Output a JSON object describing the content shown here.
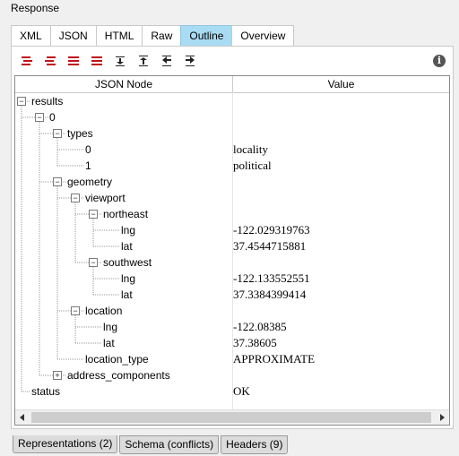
{
  "header": {
    "title": "Response"
  },
  "tabs": [
    {
      "label": "XML",
      "active": false
    },
    {
      "label": "JSON",
      "active": false
    },
    {
      "label": "HTML",
      "active": false
    },
    {
      "label": "Raw",
      "active": false
    },
    {
      "label": "Outline",
      "active": true
    },
    {
      "label": "Overview",
      "active": false
    }
  ],
  "toolbar": {
    "icons": [
      "expand-all-icon",
      "collapse-all-icon",
      "expand-children-icon",
      "collapse-children-icon",
      "move-down-icon",
      "move-up-icon",
      "move-to-top-icon",
      "move-to-bottom-icon"
    ],
    "info_label": "i"
  },
  "tree": {
    "col_node": "JSON Node",
    "col_value": "Value",
    "rows": [
      {
        "label": "results",
        "value": "",
        "depth": 0,
        "expander": "minus"
      },
      {
        "label": "0",
        "value": "",
        "depth": 1,
        "expander": "minus"
      },
      {
        "label": "types",
        "value": "",
        "depth": 2,
        "expander": "minus"
      },
      {
        "label": "0",
        "value": "locality",
        "depth": 3,
        "expander": ""
      },
      {
        "label": "1",
        "value": "political",
        "depth": 3,
        "expander": ""
      },
      {
        "label": "geometry",
        "value": "",
        "depth": 2,
        "expander": "minus"
      },
      {
        "label": "viewport",
        "value": "",
        "depth": 3,
        "expander": "minus"
      },
      {
        "label": "northeast",
        "value": "",
        "depth": 4,
        "expander": "minus"
      },
      {
        "label": "lng",
        "value": "-122.029319763",
        "depth": 5,
        "expander": ""
      },
      {
        "label": "lat",
        "value": "37.4544715881",
        "depth": 5,
        "expander": ""
      },
      {
        "label": "southwest",
        "value": "",
        "depth": 4,
        "expander": "minus"
      },
      {
        "label": "lng",
        "value": "-122.133552551",
        "depth": 5,
        "expander": ""
      },
      {
        "label": "lat",
        "value": "37.3384399414",
        "depth": 5,
        "expander": ""
      },
      {
        "label": "location",
        "value": "",
        "depth": 3,
        "expander": "minus"
      },
      {
        "label": "lng",
        "value": "-122.08385",
        "depth": 4,
        "expander": ""
      },
      {
        "label": "lat",
        "value": "37.38605",
        "depth": 4,
        "expander": ""
      },
      {
        "label": "location_type",
        "value": "APPROXIMATE",
        "depth": 3,
        "expander": ""
      },
      {
        "label": "address_components",
        "value": "",
        "depth": 2,
        "expander": "plus"
      },
      {
        "label": "status",
        "value": "OK",
        "depth": 0,
        "expander": ""
      }
    ]
  },
  "bottom_tabs": [
    {
      "label": "Representations (2)"
    },
    {
      "label": "Schema (conflicts)"
    },
    {
      "label": "Headers (9)"
    }
  ]
}
